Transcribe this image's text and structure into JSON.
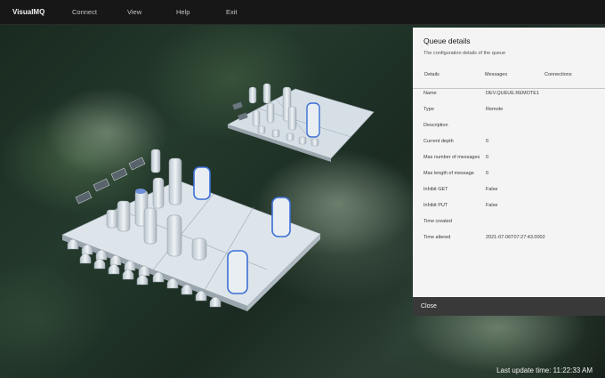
{
  "app": {
    "title": "VisualMQ"
  },
  "nav": {
    "connect": "Connect",
    "view": "View",
    "help": "Help",
    "exit": "Exit"
  },
  "panel": {
    "title": "Queue details",
    "subtitle": "The configuration details of the queue",
    "tabs": [
      "Details",
      "Messages",
      "Connections"
    ],
    "properties": [
      {
        "label": "Name",
        "value": "DEV.QUEUE.REMOTE1"
      },
      {
        "label": "Type",
        "value": "Remote"
      },
      {
        "label": "Description",
        "value": ""
      },
      {
        "label": "Current depth",
        "value": "0"
      },
      {
        "label": "Max number of messages",
        "value": "0"
      },
      {
        "label": "Max length of message",
        "value": "0"
      },
      {
        "label": "Inhibit GET",
        "value": "False"
      },
      {
        "label": "Inhibit PUT",
        "value": "False"
      },
      {
        "label": "Time created",
        "value": ""
      },
      {
        "label": "Time altered",
        "value": "2021-07-06T07:27:43.0002"
      }
    ],
    "close_label": "Close"
  },
  "status": {
    "last_update": "Last update time:  11:22:33 AM"
  },
  "colors": {
    "topbar": "#171717",
    "panel": "#f4f4f4",
    "close_bar": "#393939",
    "highlight": "#3d6fd6"
  }
}
